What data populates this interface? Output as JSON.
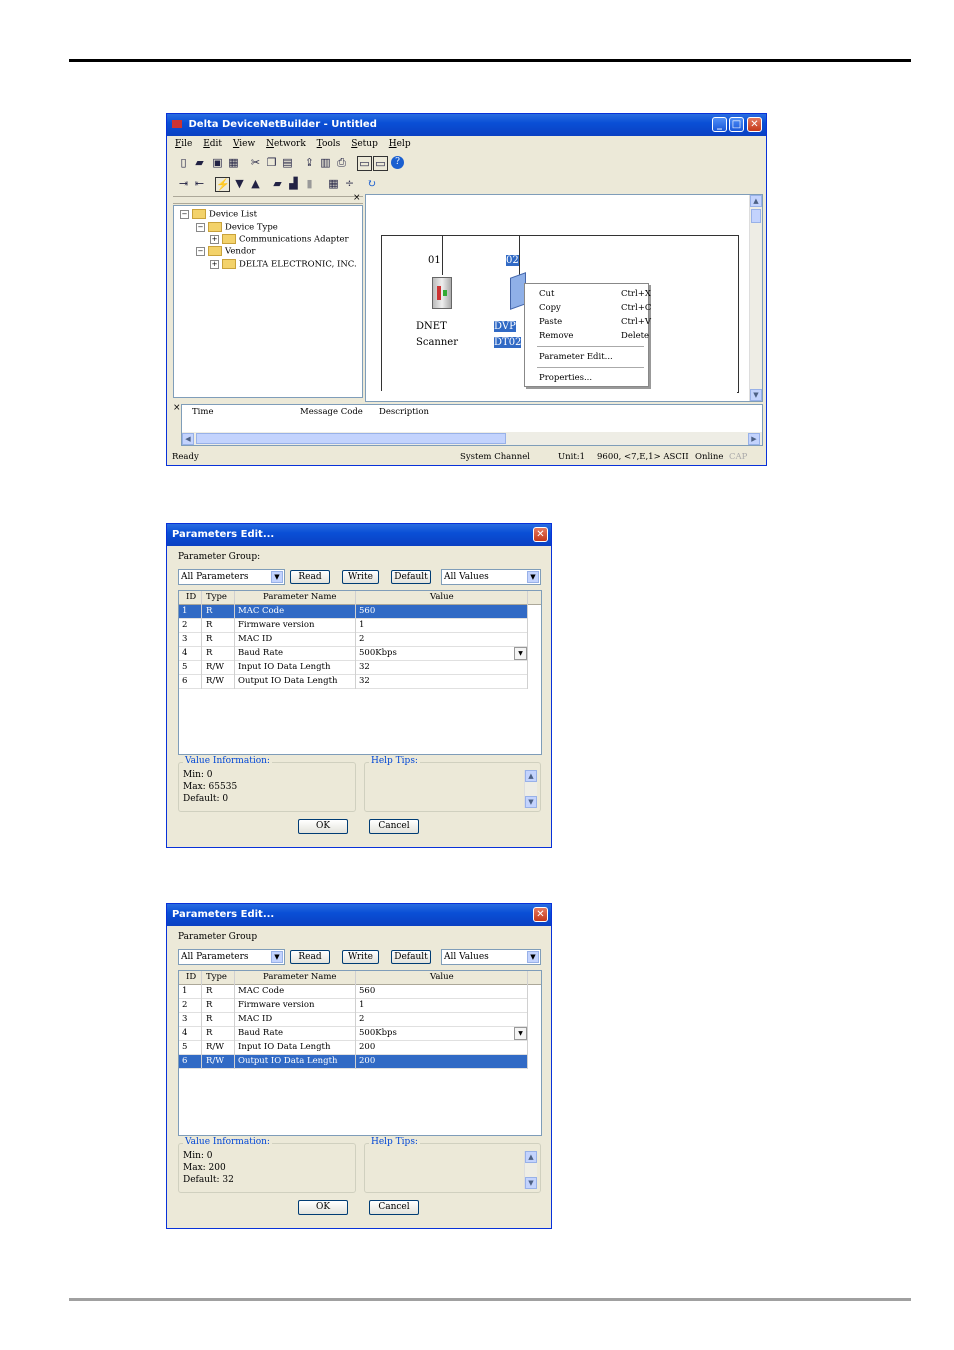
{
  "main_window": {
    "title": "Delta DeviceNetBuilder - Untitled",
    "menu": [
      "File",
      "Edit",
      "View",
      "Network",
      "Tools",
      "Setup",
      "Help"
    ],
    "tree": [
      {
        "label": "Device List",
        "expander": "−"
      },
      {
        "label": "Device Type",
        "expander": "−"
      },
      {
        "label": "Communications Adapter",
        "expander": "+"
      },
      {
        "label": "Vendor",
        "expander": "−"
      },
      {
        "label": "DELTA ELECTRONIC, INC.",
        "expander": "+"
      }
    ],
    "nodes": {
      "scanner_address": "01",
      "scanner_name_1": "DNET",
      "scanner_name_2": "Scanner",
      "slave_address": "02",
      "slave_name_1": "DVP",
      "slave_name_2": "DT02"
    },
    "context_menu": [
      {
        "label": "Cut",
        "shortcut": "Ctrl+X"
      },
      {
        "label": "Copy",
        "shortcut": "Ctrl+C"
      },
      {
        "label": "Paste",
        "shortcut": "Ctrl+V"
      },
      {
        "label": "Remove",
        "shortcut": "Delete"
      },
      {
        "label": "Parameter Edit...",
        "shortcut": ""
      },
      {
        "label": "Properties...",
        "shortcut": ""
      }
    ],
    "message_columns": [
      "Time",
      "Message Code",
      "Description"
    ],
    "status": {
      "left": "Ready",
      "channel": "System Channel",
      "unit": "Unit:1",
      "comm": "9600, <7,E,1> ASCII",
      "online": "Online",
      "cap": "CAP"
    }
  },
  "dialog1": {
    "title": "Parameters Edit...",
    "group_label": "Parameter Group:",
    "group_value": "All Parameters",
    "read": "Read",
    "write": "Write",
    "default": "Default",
    "filter_value": "All Values",
    "columns": [
      "ID",
      "Type",
      "Parameter Name",
      "Value"
    ],
    "rows": [
      [
        "1",
        "R",
        "MAC Code",
        "560"
      ],
      [
        "2",
        "R",
        "Firmware version",
        "1"
      ],
      [
        "3",
        "R",
        "MAC ID",
        "2"
      ],
      [
        "4",
        "R",
        "Baud Rate",
        "500Kbps"
      ],
      [
        "5",
        "R/W",
        "Input IO Data Length",
        "32"
      ],
      [
        "6",
        "R/W",
        "Output IO Data Length",
        "32"
      ]
    ],
    "value_info_title": "Value Information:",
    "min": "Min: 0",
    "max": "Max: 65535",
    "default_line": "Default: 0",
    "help_title": "Help Tips:",
    "ok": "OK",
    "cancel": "Cancel"
  },
  "dialog2": {
    "title": "Parameters Edit...",
    "group_label": "Parameter Group",
    "group_value": "All Parameters",
    "read": "Read",
    "write": "Write",
    "default": "Default",
    "filter_value": "All Values",
    "columns": [
      "ID",
      "Type",
      "Parameter Name",
      "Value"
    ],
    "rows": [
      [
        "1",
        "R",
        "MAC Code",
        "560"
      ],
      [
        "2",
        "R",
        "Firmware version",
        "1"
      ],
      [
        "3",
        "R",
        "MAC ID",
        "2"
      ],
      [
        "4",
        "R",
        "Baud Rate",
        "500Kbps"
      ],
      [
        "5",
        "R/W",
        "Input IO Data Length",
        "200"
      ],
      [
        "6",
        "R/W",
        "Output IO Data Length",
        "200"
      ]
    ],
    "value_info_title": "Value Information:",
    "min": "Min: 0",
    "max": "Max: 200",
    "default_line": "Default: 32",
    "help_title": "Help Tips:",
    "ok": "OK",
    "cancel": "Cancel"
  }
}
